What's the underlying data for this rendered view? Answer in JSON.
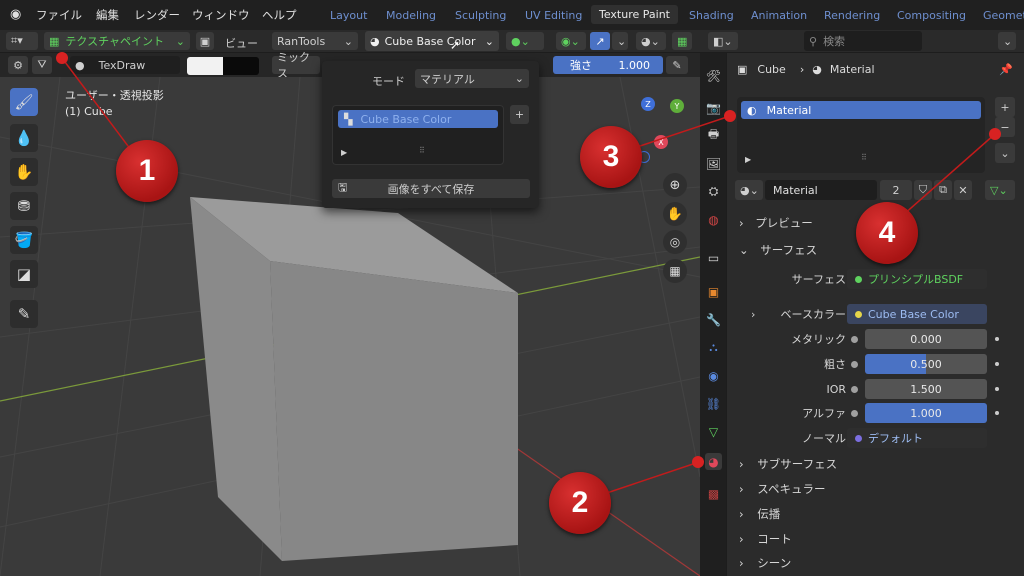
{
  "menubar": {
    "items": [
      "ファイル",
      "編集",
      "レンダー",
      "ウィンドウ",
      "ヘルプ"
    ],
    "workspaces": [
      "Layout",
      "Modeling",
      "Sculpting",
      "UV Editing",
      "Texture Paint",
      "Shading",
      "Animation",
      "Rendering",
      "Compositing",
      "Geomet"
    ],
    "active_workspace": "Texture Paint"
  },
  "header": {
    "mode": "テクスチャペイント",
    "view": "ビュー",
    "addon": "RanTools",
    "texture_slot": "Cube Base Color",
    "search_placeholder": "検索"
  },
  "brushbar": {
    "brush": "TexDraw",
    "blend": "ミックス",
    "strength_label": "強さ",
    "strength_value": "1.000"
  },
  "viewport": {
    "overlay_line1": "ユーザー・透視投影",
    "overlay_line2": "(1) Cube",
    "gizmo_x": "X",
    "gizmo_y": "Y",
    "gizmo_z": "Z"
  },
  "popup": {
    "mode_label": "モード",
    "mode_value": "マテリアル",
    "slot_item": "Cube Base Color",
    "save_all": "画像をすべて保存"
  },
  "properties": {
    "object_name": "Cube",
    "material_breadcrumb": "Material",
    "material_slot": "Material",
    "material_name": "Material",
    "user_count": "2",
    "sections": {
      "preview": "プレビュー",
      "surface": "サーフェス",
      "subsurface": "サブサーフェス",
      "specular": "スペキュラー",
      "transmission": "伝播",
      "coat": "コート",
      "sheen": "シーン"
    },
    "surface_label": "サーフェス",
    "surface_value": "プリンシプルBSDF",
    "base_color_label": "ベースカラー",
    "base_color_value": "Cube Base Color",
    "metallic_label": "メタリック",
    "metallic_value": "0.000",
    "roughness_label": "粗さ",
    "roughness_value": "0.500",
    "ior_label": "IOR",
    "ior_value": "1.500",
    "alpha_label": "アルファ",
    "alpha_value": "1.000",
    "normal_label": "ノーマル",
    "normal_value": "デフォルト"
  },
  "markers": [
    "1",
    "2",
    "3",
    "4"
  ],
  "colors": {
    "accent_blue": "#4a72c4",
    "marker_red": "#c21b1b",
    "material_green": "#5fd25f"
  },
  "roughness_fill": 0.5
}
